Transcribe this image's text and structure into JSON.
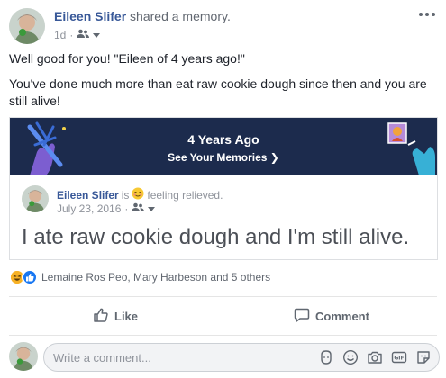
{
  "post": {
    "author": "Eileen Slifer",
    "action": "shared a memory.",
    "time": "1d",
    "privacy_icon": "friends-icon",
    "body_line1": "Well good for you! \"Eileen of 4 years ago!\"",
    "body_line2": "You've done much more than eat raw cookie dough since then and you are still alive!"
  },
  "memory": {
    "title": "4 Years Ago",
    "link": "See Your Memories",
    "link_arrow": "❯",
    "inner_author": "Eileen Slifer",
    "inner_is": "is",
    "inner_feeling": "feeling relieved.",
    "inner_date": "July 23, 2016",
    "inner_text": "I ate raw cookie dough and I'm still alive."
  },
  "reactions": {
    "text": "Lemaine Ros Peo, Mary Harbeson and 5 others"
  },
  "actions": {
    "like": "Like",
    "comment": "Comment"
  },
  "comment_box": {
    "placeholder": "Write a comment..."
  },
  "colors": {
    "link_blue": "#385898",
    "banner_bg": "#1c2b4d",
    "like_blue": "#1877f2",
    "haha_yellow": "#f7b125"
  }
}
